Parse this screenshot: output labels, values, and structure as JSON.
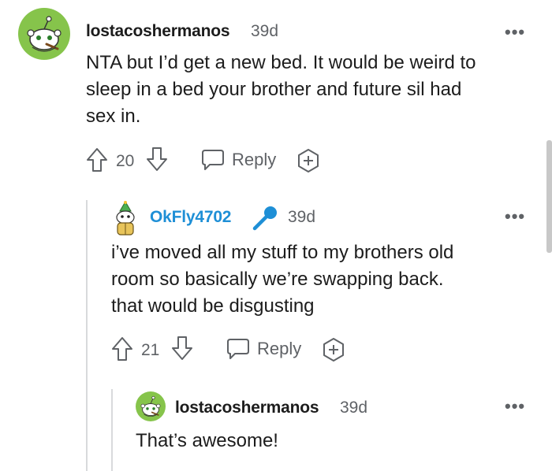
{
  "comments": [
    {
      "username": "lostacoshermanos",
      "time": "39d",
      "text_lines": [
        "NTA but I’d get a new bed. It would be weird to",
        "sleep in a bed your brother and future sil had",
        "sex in."
      ],
      "votes": "20",
      "reply_label": "Reply",
      "more_label": "•••"
    },
    {
      "username": "OkFly4702",
      "is_op": true,
      "time": "39d",
      "text_lines": [
        "i’ve moved all my stuff to my brothers old",
        "room so basically we’re swapping back.",
        "that would be disgusting"
      ],
      "votes": "21",
      "reply_label": "Reply",
      "more_label": "•••"
    },
    {
      "username": "lostacoshermanos",
      "time": "39d",
      "text_lines": [
        "That’s awesome!"
      ],
      "more_label": "•••"
    }
  ],
  "icons": {
    "avatar": "snoo-avatar-icon",
    "op_badge": "microphone-icon",
    "upvote": "upvote-arrow-icon",
    "downvote": "downvote-arrow-icon",
    "reply": "speech-bubble-icon",
    "award": "award-plus-icon"
  },
  "colors": {
    "op_username": "#1e8fd6",
    "avatar_bg": "#86c44b",
    "meta_gray": "#5f6266"
  }
}
